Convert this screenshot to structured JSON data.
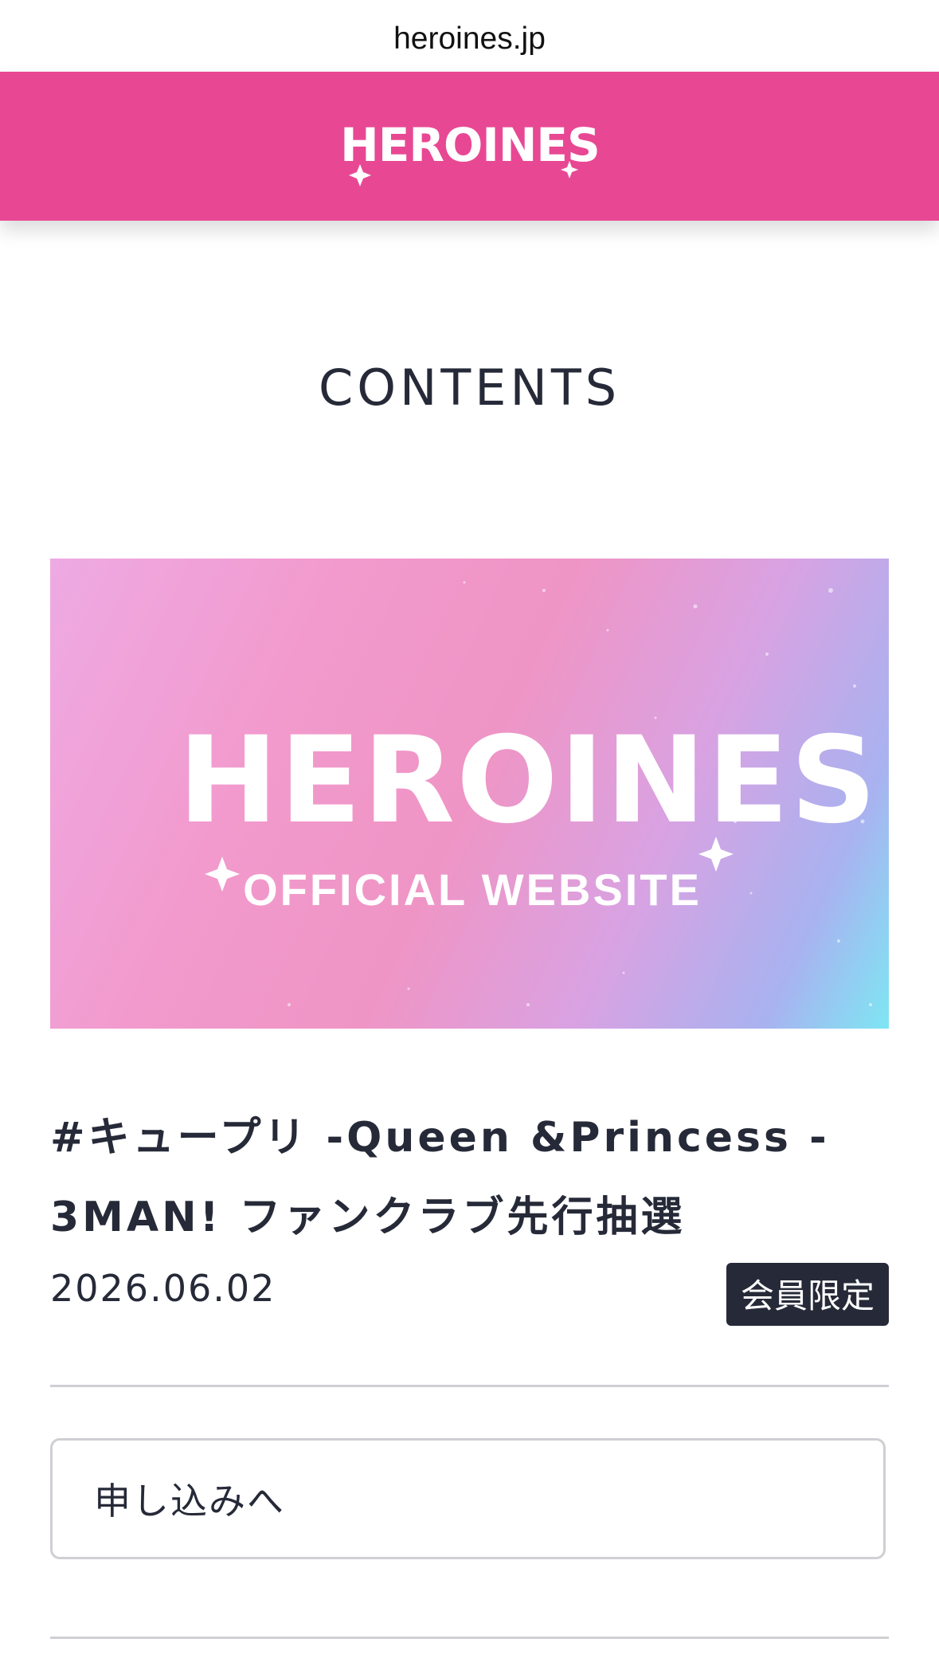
{
  "browser": {
    "url": "heroines.jp"
  },
  "header": {
    "logo_text": "HEROINES",
    "logo_icon": "heroines-logo"
  },
  "page": {
    "section_title": "CONTENTS"
  },
  "banner": {
    "logo_text": "HEROINES",
    "subtitle": "OFFICIAL WEBSITE"
  },
  "article": {
    "title_line1": "#キュープリ -Queen &Princess -",
    "title_line2": "3MAN! ファンクラブ先行抽選",
    "date": "2026.06.02",
    "badge": "会員限定",
    "apply_label": "申し込みへ"
  },
  "colors": {
    "brand_pink": "#e84893",
    "text_dark": "#262a38",
    "divider": "#cfcfd4"
  }
}
